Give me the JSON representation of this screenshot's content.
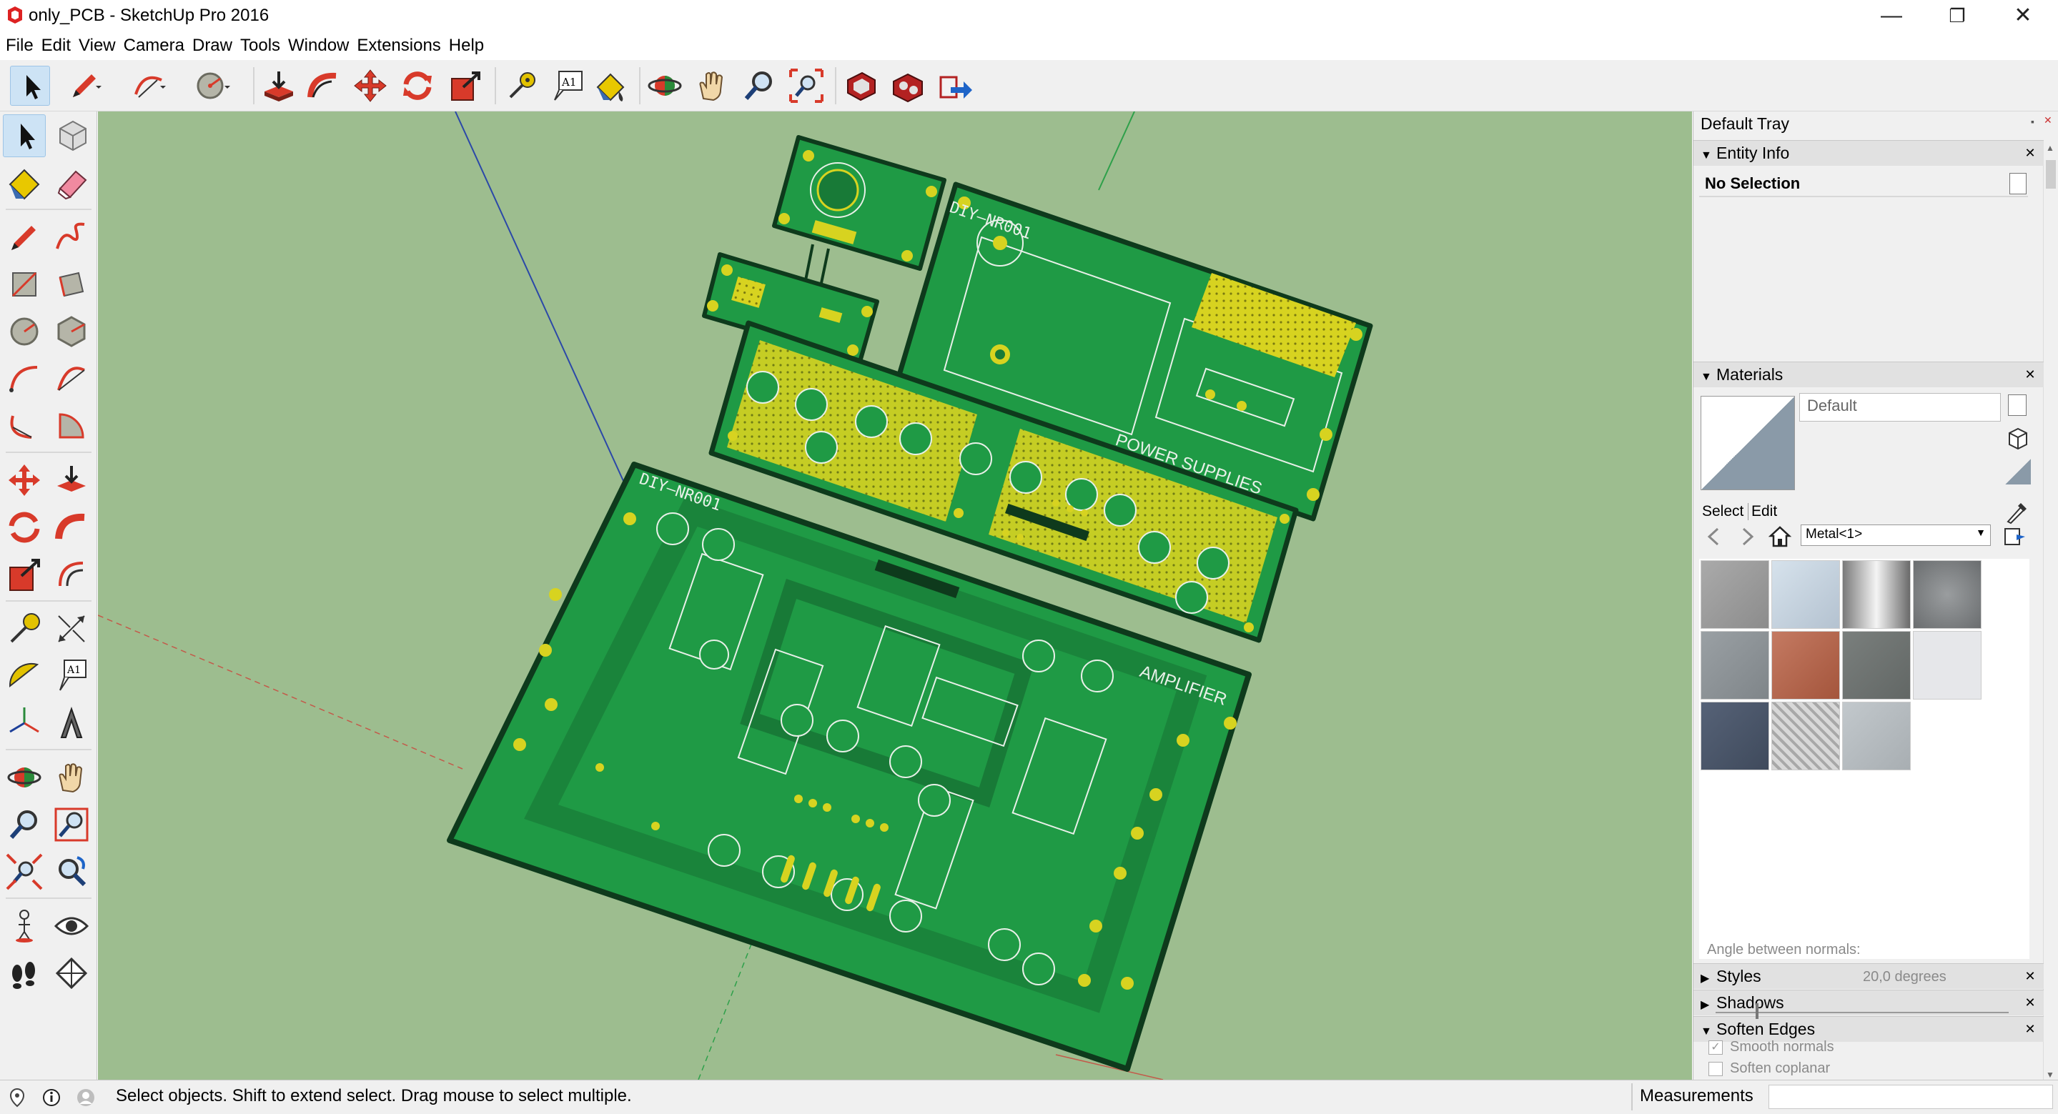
{
  "window": {
    "title": "only_PCB - SketchUp Pro 2016",
    "minimize": "—",
    "restore": "❐",
    "close": "✕"
  },
  "menu": [
    "File",
    "Edit",
    "View",
    "Camera",
    "Draw",
    "Tools",
    "Window",
    "Extensions",
    "Help"
  ],
  "toolbar_icons": [
    "select-icon",
    "pencil-icon",
    "arc-icon",
    "circle-icon",
    "push-pull-icon",
    "follow-me-icon",
    "move-icon",
    "rotate-icon",
    "scale-icon",
    "tape-measure-icon",
    "text-icon",
    "paint-bucket-icon",
    "orbit-icon",
    "pan-icon",
    "zoom-icon",
    "zoom-extents-icon",
    "warehouse-icon",
    "extension-warehouse-icon",
    "share-model-icon"
  ],
  "left_tools": [
    "select-icon",
    "component-icon",
    "paint-bucket-icon",
    "eraser-icon",
    "line-icon",
    "freehand-icon",
    "rectangle-icon",
    "rotated-rectangle-icon",
    "circle-icon",
    "polygon-icon",
    "arc-icon",
    "two-point-arc-icon",
    "three-point-arc-icon",
    "pie-icon",
    "move-icon",
    "push-pull-icon",
    "rotate-icon",
    "follow-me-icon",
    "scale-icon",
    "offset-icon",
    "tape-measure-icon",
    "dimension-icon",
    "protractor-icon",
    "text-icon",
    "axes-icon",
    "3d-text-icon",
    "orbit-icon",
    "pan-icon",
    "zoom-icon",
    "zoom-window-icon",
    "zoom-extents-icon",
    "previous-view-icon",
    "position-camera-icon",
    "look-around-icon",
    "walk-icon",
    "section-plane-icon"
  ],
  "viewport": {
    "pcb_labels": [
      "DIY–NR001",
      "POWER SUPPLIES",
      "DIY–NR001",
      "AMPLIFIER"
    ],
    "colors": {
      "background": "#9dbd8f",
      "board": "#1f9a45",
      "board_dark": "#187a37",
      "edge": "#0e3a1c",
      "copper": "#d7d320",
      "silk": "#e8f0e8"
    }
  },
  "tray": {
    "title": "Default Tray",
    "entity_info": {
      "header": "Entity Info",
      "value": "No Selection"
    },
    "materials": {
      "header": "Materials",
      "current": "Default",
      "tab_select": "Select",
      "tab_edit": "Edit",
      "library": "Metal<1>",
      "swatch_colors": [
        "#9c9c9c",
        "#c0ccd6",
        "#b8b8b8",
        "#7b7e80",
        "#8d9397",
        "#b3664e",
        "#6f7472",
        "#e4e5e8",
        "#4a5669",
        "#c8c8c8",
        "#b5bcc0"
      ]
    },
    "styles": "Styles",
    "shadows": "Shadows",
    "soften_edges": {
      "header": "Soften Edges",
      "angle_label": "Angle between normals:",
      "angle_value": "20,0  degrees",
      "smooth_label": "Smooth normals",
      "coplanar_label": "Soften coplanar",
      "smooth_checked": true,
      "coplanar_checked": false
    }
  },
  "status": {
    "message": "Select objects. Shift to extend select. Drag mouse to select multiple.",
    "measurements": "Measurements"
  }
}
